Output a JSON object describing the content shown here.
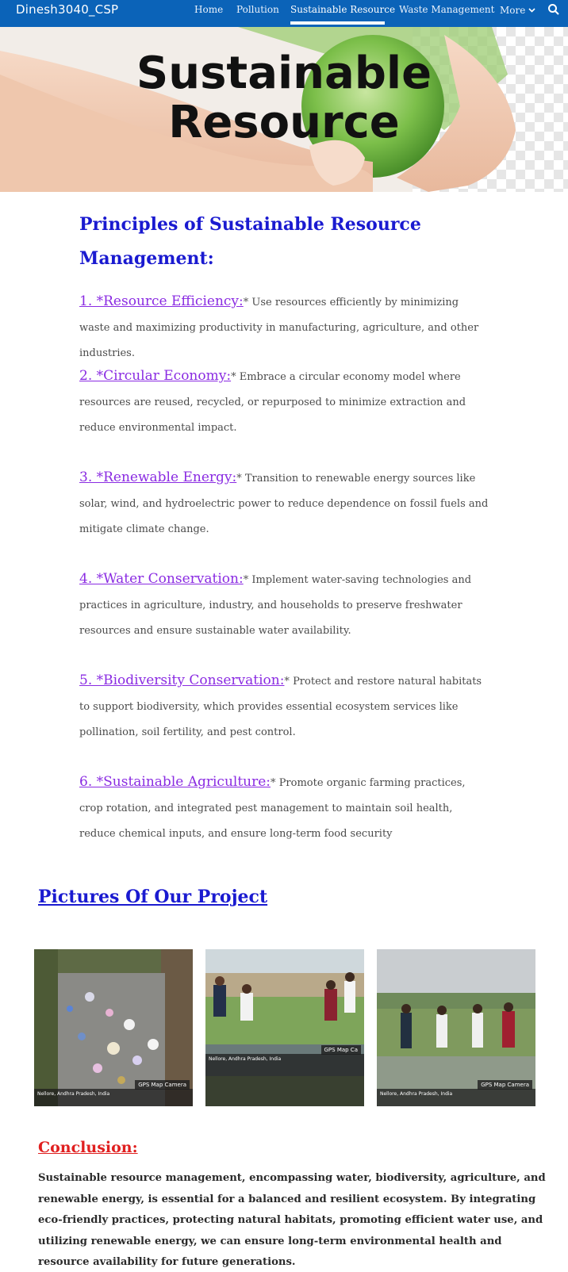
{
  "nav": {
    "site_title": "Dinesh3040_CSP",
    "links": [
      "Home",
      "Pollution",
      "Sustainable Resource",
      "Waste Management"
    ],
    "more_label": "More"
  },
  "hero": {
    "title_line1": "Sustainable",
    "title_line2": "Resource"
  },
  "principles": {
    "heading": "Principles of Sustainable Resource Management:",
    "items": [
      {
        "label": "1. *Resource Efficiency:",
        "text": "Use resources efficiently by minimizing waste and maximizing productivity in manufacturing, agriculture, and other industries."
      },
      {
        "label": "2. *Circular Economy:",
        "text": "Embrace a circular economy model where resources are reused, recycled, or repurposed to minimize extraction and reduce environmental impact."
      },
      {
        "label": "3. *Renewable Energy:",
        "text": "Transition to renewable energy sources like solar, wind, and hydroelectric power to reduce dependence on fossil fuels and mitigate climate change."
      },
      {
        "label": "4. *Water Conservation:",
        "text": "Implement water-saving technologies and practices in agriculture, industry, and households to preserve freshwater resources and ensure sustainable water availability."
      },
      {
        "label": "5. *Biodiversity Conservation:",
        "text": "Protect and restore natural habitats to support biodiversity, which provides essential ecosystem services like pollination, soil fertility, and pest control."
      },
      {
        "label": "6. *Sustainable Agriculture:",
        "text": "Promote organic farming practices, crop rotation, and integrated pest management to maintain soil health, reduce chemical inputs, and ensure long-term food security"
      }
    ]
  },
  "pictures": {
    "heading": "Pictures Of Our Project",
    "photos": [
      {
        "stamp_brand": "GPS Map Camera",
        "stamp_text": "Nellore, Andhra Pradesh, India"
      },
      {
        "stamp_brand": "GPS Map Ca",
        "stamp_text": "Nellore, Andhra Pradesh, India"
      },
      {
        "stamp_brand": "GPS Map Camera",
        "stamp_text": "Nellore, Andhra Pradesh, India"
      }
    ]
  },
  "conclusion": {
    "heading": "Conclusion:",
    "text": "Sustainable resource management, encompassing water, biodiversity, agriculture, and renewable energy, is essential for a balanced and resilient ecosystem. By integrating eco-friendly practices, protecting natural habitats, promoting efficient water use, and utilizing renewable energy, we can ensure long-term environmental health and resource availability for future generations."
  },
  "colors": {
    "nav_bg": "#0b63b8",
    "heading_blue": "#1a1ad0",
    "item_label": "#8a2be2",
    "conclusion_red": "#e02020"
  }
}
